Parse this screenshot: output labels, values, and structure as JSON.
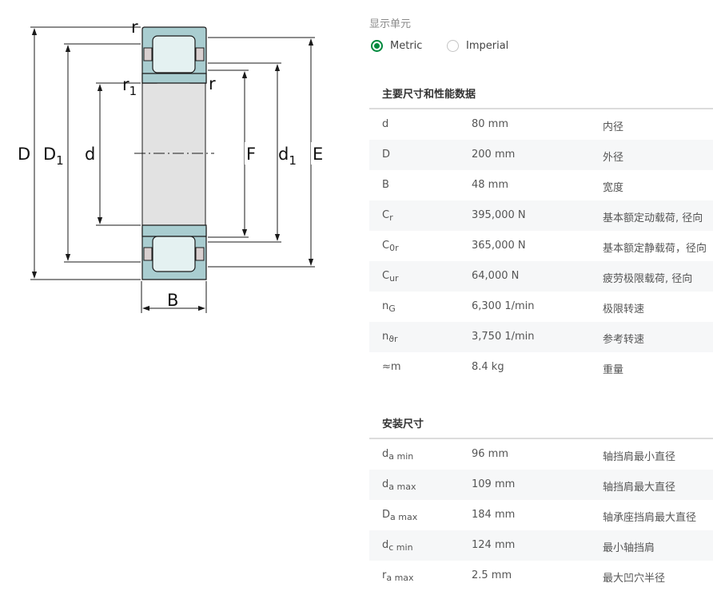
{
  "drawing": {
    "labels": {
      "D": "D",
      "D1_main": "D",
      "D1_sub": "1",
      "d": "d",
      "F": "F",
      "d1_main": "d",
      "d1_sub": "1",
      "E": "E",
      "B": "B",
      "r": "r",
      "r1_main": "r",
      "r1_sub": "1"
    },
    "colors": {
      "ring": "#a9cdd0",
      "roller": "#e4f1f1",
      "bore": "#e2e2e2",
      "outline": "#1a1a1a"
    }
  },
  "units": {
    "title": "显示单元",
    "options": [
      {
        "label": "Metric",
        "checked": true
      },
      {
        "label": "Imperial",
        "checked": false
      }
    ],
    "accent_color": "#00893d"
  },
  "main_dims": {
    "title": "主要尺寸和性能数据",
    "rows": [
      {
        "sym": "d",
        "sub": "",
        "value": "80 mm",
        "desc": "内径"
      },
      {
        "sym": "D",
        "sub": "",
        "value": "200 mm",
        "desc": "外径"
      },
      {
        "sym": "B",
        "sub": "",
        "value": "48 mm",
        "desc": "宽度"
      },
      {
        "sym": "C",
        "sub": "r",
        "value": "395,000 N",
        "desc": "基本额定动载荷, 径向"
      },
      {
        "sym": "C",
        "sub": "0r",
        "value": "365,000 N",
        "desc": "基本额定静载荷，径向"
      },
      {
        "sym": "C",
        "sub": "ur",
        "value": "64,000 N",
        "desc": "疲劳极限载荷, 径向"
      },
      {
        "sym": "n",
        "sub": "G",
        "value": "6,300 1/min",
        "desc": "极限转速"
      },
      {
        "sym": "n",
        "sub": "ϑr",
        "value": "3,750 1/min",
        "desc": "参考转速"
      },
      {
        "sym": "≈m",
        "sub": "",
        "value": "8.4 kg",
        "desc": "重量"
      }
    ]
  },
  "mounting_dims": {
    "title": "安装尺寸",
    "rows": [
      {
        "sym": "d",
        "sub": "a min",
        "value": "96 mm",
        "desc": "轴挡肩最小直径"
      },
      {
        "sym": "d",
        "sub": "a max",
        "value": "109 mm",
        "desc": "轴挡肩最大直径"
      },
      {
        "sym": "D",
        "sub": "a max",
        "value": "184 mm",
        "desc": "轴承座挡肩最大直径"
      },
      {
        "sym": "d",
        "sub": "c min",
        "value": "124 mm",
        "desc": "最小轴挡肩"
      },
      {
        "sym": "r",
        "sub": "a max",
        "value": "2.5 mm",
        "desc": "最大凹穴半径"
      }
    ]
  }
}
